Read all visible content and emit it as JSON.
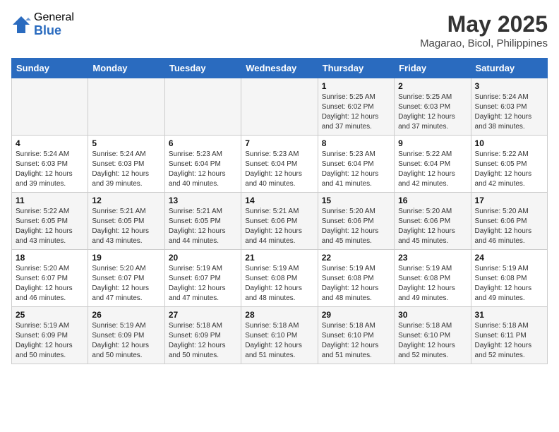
{
  "header": {
    "logo_general": "General",
    "logo_blue": "Blue",
    "month": "May 2025",
    "location": "Magarao, Bicol, Philippines"
  },
  "days_of_week": [
    "Sunday",
    "Monday",
    "Tuesday",
    "Wednesday",
    "Thursday",
    "Friday",
    "Saturday"
  ],
  "weeks": [
    [
      {
        "day": "",
        "info": ""
      },
      {
        "day": "",
        "info": ""
      },
      {
        "day": "",
        "info": ""
      },
      {
        "day": "",
        "info": ""
      },
      {
        "day": "1",
        "info": "Sunrise: 5:25 AM\nSunset: 6:02 PM\nDaylight: 12 hours\nand 37 minutes."
      },
      {
        "day": "2",
        "info": "Sunrise: 5:25 AM\nSunset: 6:03 PM\nDaylight: 12 hours\nand 37 minutes."
      },
      {
        "day": "3",
        "info": "Sunrise: 5:24 AM\nSunset: 6:03 PM\nDaylight: 12 hours\nand 38 minutes."
      }
    ],
    [
      {
        "day": "4",
        "info": "Sunrise: 5:24 AM\nSunset: 6:03 PM\nDaylight: 12 hours\nand 39 minutes."
      },
      {
        "day": "5",
        "info": "Sunrise: 5:24 AM\nSunset: 6:03 PM\nDaylight: 12 hours\nand 39 minutes."
      },
      {
        "day": "6",
        "info": "Sunrise: 5:23 AM\nSunset: 6:04 PM\nDaylight: 12 hours\nand 40 minutes."
      },
      {
        "day": "7",
        "info": "Sunrise: 5:23 AM\nSunset: 6:04 PM\nDaylight: 12 hours\nand 40 minutes."
      },
      {
        "day": "8",
        "info": "Sunrise: 5:23 AM\nSunset: 6:04 PM\nDaylight: 12 hours\nand 41 minutes."
      },
      {
        "day": "9",
        "info": "Sunrise: 5:22 AM\nSunset: 6:04 PM\nDaylight: 12 hours\nand 42 minutes."
      },
      {
        "day": "10",
        "info": "Sunrise: 5:22 AM\nSunset: 6:05 PM\nDaylight: 12 hours\nand 42 minutes."
      }
    ],
    [
      {
        "day": "11",
        "info": "Sunrise: 5:22 AM\nSunset: 6:05 PM\nDaylight: 12 hours\nand 43 minutes."
      },
      {
        "day": "12",
        "info": "Sunrise: 5:21 AM\nSunset: 6:05 PM\nDaylight: 12 hours\nand 43 minutes."
      },
      {
        "day": "13",
        "info": "Sunrise: 5:21 AM\nSunset: 6:05 PM\nDaylight: 12 hours\nand 44 minutes."
      },
      {
        "day": "14",
        "info": "Sunrise: 5:21 AM\nSunset: 6:06 PM\nDaylight: 12 hours\nand 44 minutes."
      },
      {
        "day": "15",
        "info": "Sunrise: 5:20 AM\nSunset: 6:06 PM\nDaylight: 12 hours\nand 45 minutes."
      },
      {
        "day": "16",
        "info": "Sunrise: 5:20 AM\nSunset: 6:06 PM\nDaylight: 12 hours\nand 45 minutes."
      },
      {
        "day": "17",
        "info": "Sunrise: 5:20 AM\nSunset: 6:06 PM\nDaylight: 12 hours\nand 46 minutes."
      }
    ],
    [
      {
        "day": "18",
        "info": "Sunrise: 5:20 AM\nSunset: 6:07 PM\nDaylight: 12 hours\nand 46 minutes."
      },
      {
        "day": "19",
        "info": "Sunrise: 5:20 AM\nSunset: 6:07 PM\nDaylight: 12 hours\nand 47 minutes."
      },
      {
        "day": "20",
        "info": "Sunrise: 5:19 AM\nSunset: 6:07 PM\nDaylight: 12 hours\nand 47 minutes."
      },
      {
        "day": "21",
        "info": "Sunrise: 5:19 AM\nSunset: 6:08 PM\nDaylight: 12 hours\nand 48 minutes."
      },
      {
        "day": "22",
        "info": "Sunrise: 5:19 AM\nSunset: 6:08 PM\nDaylight: 12 hours\nand 48 minutes."
      },
      {
        "day": "23",
        "info": "Sunrise: 5:19 AM\nSunset: 6:08 PM\nDaylight: 12 hours\nand 49 minutes."
      },
      {
        "day": "24",
        "info": "Sunrise: 5:19 AM\nSunset: 6:08 PM\nDaylight: 12 hours\nand 49 minutes."
      }
    ],
    [
      {
        "day": "25",
        "info": "Sunrise: 5:19 AM\nSunset: 6:09 PM\nDaylight: 12 hours\nand 50 minutes."
      },
      {
        "day": "26",
        "info": "Sunrise: 5:19 AM\nSunset: 6:09 PM\nDaylight: 12 hours\nand 50 minutes."
      },
      {
        "day": "27",
        "info": "Sunrise: 5:18 AM\nSunset: 6:09 PM\nDaylight: 12 hours\nand 50 minutes."
      },
      {
        "day": "28",
        "info": "Sunrise: 5:18 AM\nSunset: 6:10 PM\nDaylight: 12 hours\nand 51 minutes."
      },
      {
        "day": "29",
        "info": "Sunrise: 5:18 AM\nSunset: 6:10 PM\nDaylight: 12 hours\nand 51 minutes."
      },
      {
        "day": "30",
        "info": "Sunrise: 5:18 AM\nSunset: 6:10 PM\nDaylight: 12 hours\nand 52 minutes."
      },
      {
        "day": "31",
        "info": "Sunrise: 5:18 AM\nSunset: 6:11 PM\nDaylight: 12 hours\nand 52 minutes."
      }
    ]
  ]
}
